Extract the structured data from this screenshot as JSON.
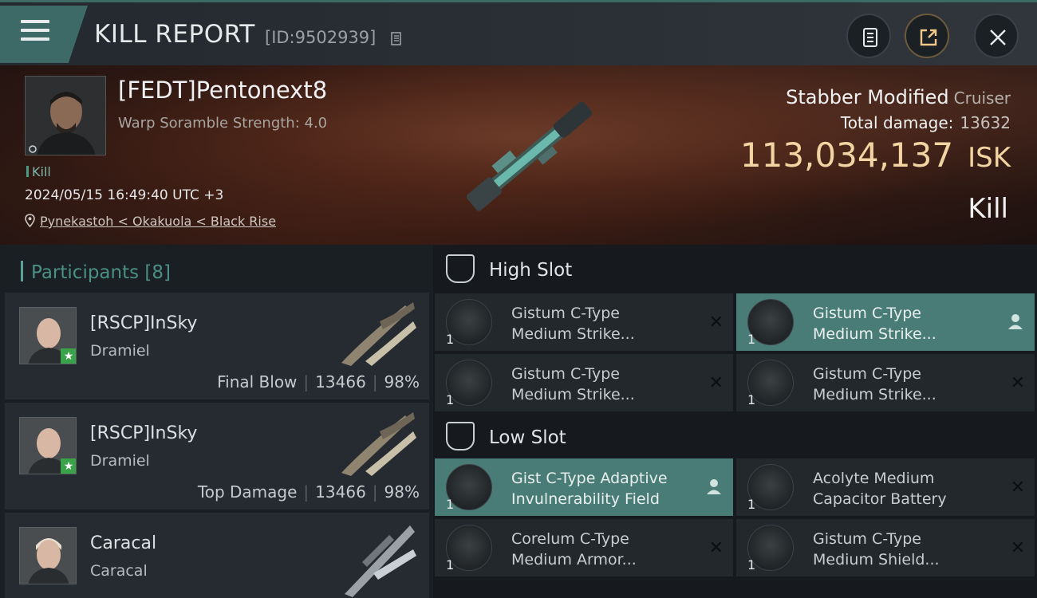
{
  "header": {
    "title": "KILL REPORT",
    "report_id": "[ID:9502939]"
  },
  "victim": {
    "name": "[FEDT]Pentonext8",
    "subtitle": "Warp Soramble Strength: 4.0",
    "tag": "Kill",
    "datetime": "2024/05/15 16:49:40 UTC +3",
    "location": "Pynekastoh < Okakuola < Black Rise",
    "ship_name": "Stabber Modified",
    "ship_class": "Cruiser",
    "total_damage_label": "Total damage:",
    "total_damage_value": "13632",
    "isk_value": "113,034,137",
    "isk_unit": "ISK",
    "result": "Kill"
  },
  "participants": {
    "label": "Participants",
    "count": "[8]",
    "rows": [
      {
        "name": "[RSCP]InSky",
        "ship": "Dramiel",
        "role": "Final Blow",
        "damage": "13466",
        "percent": "98%"
      },
      {
        "name": "[RSCP]InSky",
        "ship": "Dramiel",
        "role": "Top Damage",
        "damage": "13466",
        "percent": "98%"
      },
      {
        "name": "Caracal",
        "ship": "Caracal"
      }
    ]
  },
  "slots": {
    "high": {
      "label": "High Slot",
      "modules": [
        {
          "line1": "Gistum C-Type",
          "line2": "Medium Strike...",
          "qty": "1"
        },
        {
          "line1": "Gistum C-Type",
          "line2": "Medium Strike...",
          "qty": "1"
        },
        {
          "line1": "Gistum C-Type",
          "line2": "Medium Strike...",
          "qty": "1"
        },
        {
          "line1": "Gistum C-Type",
          "line2": "Medium Strike...",
          "qty": "1"
        }
      ]
    },
    "low": {
      "label": "Low Slot",
      "modules": [
        {
          "line1": "Gist C-Type Adaptive",
          "line2": "Invulnerability Field",
          "qty": "1"
        },
        {
          "line1": "Acolyte Medium",
          "line2": "Capacitor Battery",
          "qty": "1"
        },
        {
          "line1": "Corelum C-Type",
          "line2": "Medium Armor...",
          "qty": "1"
        },
        {
          "line1": "Gistum C-Type",
          "line2": "Medium Shield...",
          "qty": "1"
        }
      ]
    }
  },
  "colors": {
    "accent_teal": "#4a7c77",
    "isk_gold": "#f2d5a2",
    "panel_dark": "#1a1f23"
  },
  "icons": [
    "menu-icon",
    "copy-icon",
    "clipboard-icon",
    "share-icon",
    "close-icon",
    "location-pin-icon",
    "high-slot-icon",
    "low-slot-icon",
    "user-icon",
    "remove-x-icon"
  ]
}
